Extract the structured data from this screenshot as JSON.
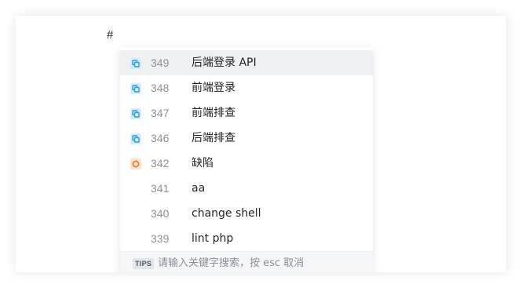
{
  "editor": {
    "trigger_char": "#"
  },
  "suggestions": [
    {
      "id": "349",
      "title": "后端登录 API",
      "icon": "task-icon",
      "icon_color": "#2d9cdb",
      "active": true
    },
    {
      "id": "348",
      "title": "前端登录",
      "icon": "task-icon",
      "icon_color": "#2d9cdb",
      "active": false
    },
    {
      "id": "347",
      "title": "前端排查",
      "icon": "task-icon",
      "icon_color": "#2d9cdb",
      "active": false
    },
    {
      "id": "346",
      "title": "后端排查",
      "icon": "task-icon",
      "icon_color": "#2d9cdb",
      "active": false
    },
    {
      "id": "342",
      "title": "缺陷",
      "icon": "bug-icon",
      "icon_color": "#f27a2c",
      "active": false
    },
    {
      "id": "341",
      "title": "aa",
      "icon": "",
      "icon_color": "",
      "active": false
    },
    {
      "id": "340",
      "title": "change shell",
      "icon": "",
      "icon_color": "",
      "active": false
    },
    {
      "id": "339",
      "title": "lint php",
      "icon": "",
      "icon_color": "",
      "active": false
    }
  ],
  "footer": {
    "badge": "TIPS",
    "text": "请输入关键字搜索，按 esc 取消"
  }
}
